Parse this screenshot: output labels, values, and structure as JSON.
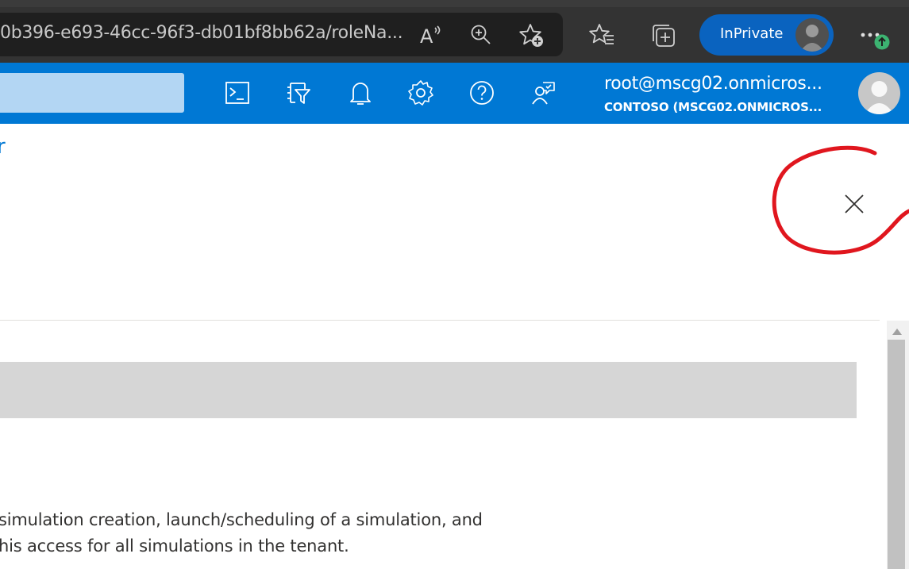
{
  "browser": {
    "address_bar": {
      "url_text": "0b396-e693-46cc-96f3-db01bf8bb62a/roleNa..."
    },
    "toolbar_icons": [
      "read-aloud-icon",
      "zoom-icon",
      "add-favorite-icon",
      "favorites-icon",
      "collections-icon",
      "more-icon",
      "update-badge-icon"
    ],
    "inprivate_label": "InPrivate"
  },
  "portal_header": {
    "icons": [
      "cloud-shell-icon",
      "directory-filter-icon",
      "notifications-icon",
      "settings-icon",
      "help-icon",
      "feedback-icon"
    ],
    "user": {
      "email": "root@mscg02.onmicros...",
      "tenant": "CONTOSO (MSCG02.ONMICROS..."
    }
  },
  "blade": {
    "breadcrumb_fragment": "r",
    "close_icon": "close-icon",
    "annotation_color": "#e0161e",
    "description_lines": [
      "simulation creation, launch/scheduling of a simulation, and",
      "his access for all simulations in the tenant."
    ]
  },
  "colors": {
    "accent": "#0078d4",
    "browser_chrome": "#333333",
    "inprivate": "#0a63bf"
  }
}
